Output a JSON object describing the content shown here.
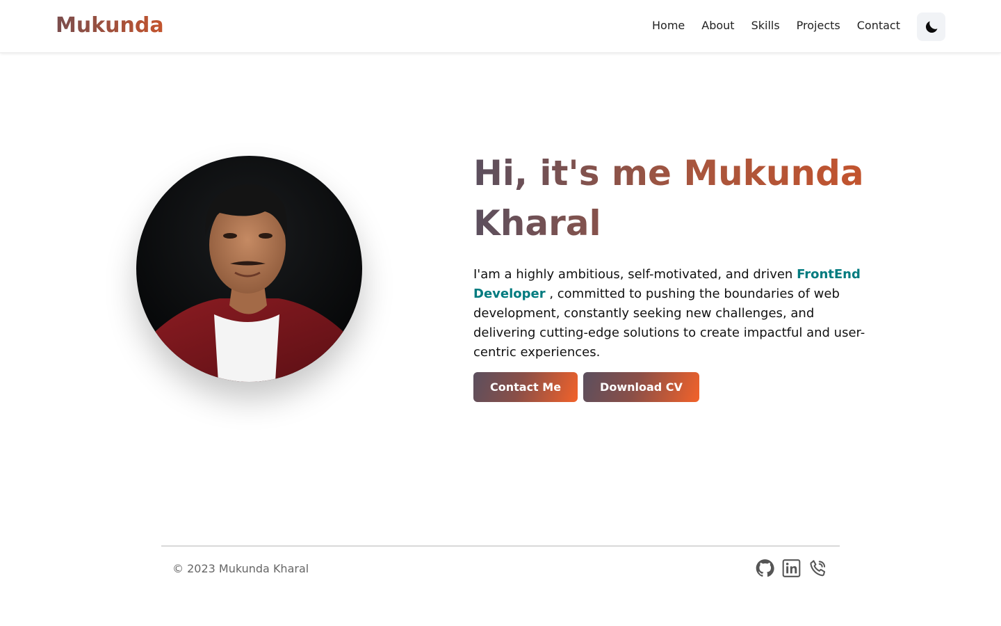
{
  "brand": {
    "logo_text": "Mukunda"
  },
  "nav": {
    "items": [
      {
        "label": "Home"
      },
      {
        "label": "About"
      },
      {
        "label": "Skills"
      },
      {
        "label": "Projects"
      },
      {
        "label": "Contact"
      }
    ],
    "theme_toggle_icon": "moon-icon"
  },
  "hero": {
    "greeting": "Hi, it's me Mukunda Kharal",
    "bio_before": "I'am a highly ambitious, self-motivated, and driven ",
    "bio_highlight": "FrontEnd Developer",
    "bio_after": " , committed to pushing the boundaries of web development, constantly seeking new challenges, and delivering cutting-edge solutions to create impactful and user-centric experiences.",
    "primary_button": "Contact Me",
    "secondary_button": "Download CV"
  },
  "footer": {
    "copyright": "© 2023 Mukunda Kharal",
    "social_icons": [
      "github-icon",
      "linkedin-icon",
      "phone-icon"
    ]
  },
  "colors": {
    "brand_gradient_start": "#5b4f5e",
    "brand_gradient_end": "#f2622a",
    "highlight": "#007b7f"
  }
}
